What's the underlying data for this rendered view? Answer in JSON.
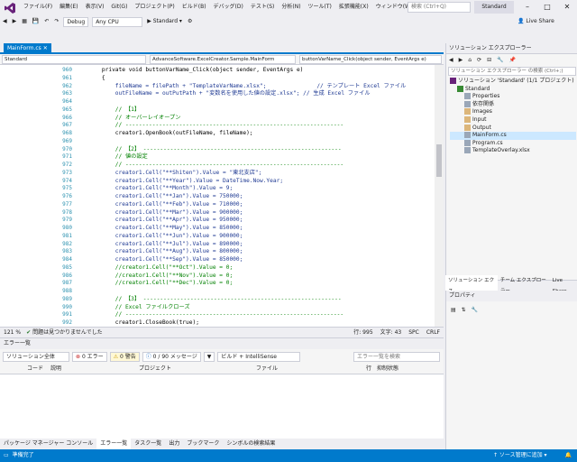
{
  "menu": {
    "items": [
      "ファイル(F)",
      "編集(E)",
      "表示(V)",
      "Git(G)",
      "プロジェクト(P)",
      "ビルド(B)",
      "デバッグ(D)",
      "テスト(S)",
      "分析(N)",
      "ツール(T)",
      "拡張機能(X)",
      "ウィンドウ(W)",
      "ヘルプ(H)"
    ],
    "search_placeholder": "検索 (Ctrl+Q)",
    "solution_name": "Standard"
  },
  "toolbar": {
    "config": "Debug",
    "platform": "Any CPU",
    "run_label": "▶ Standard ▾",
    "live_share": "Live Share"
  },
  "tabs": {
    "active": "MainForm.cs",
    "nav1": "Standard",
    "nav2": "AdvanceSoftware.ExcelCreator.Sample.MainForm",
    "nav3": "buttonVarName_Click(object sender, EventArgs e)"
  },
  "code": {
    "lines": [
      {
        "n": "960",
        "t": "    private void buttonVarName_Click(object sender, EventArgs e)",
        "k": "plain"
      },
      {
        "n": "961",
        "t": "    {",
        "k": "plain"
      },
      {
        "n": "962",
        "t": "        fileName = filePath + \"TemplateVarName.xlsx\";               // テンプレート Excel ファイル",
        "k": "mixed"
      },
      {
        "n": "963",
        "t": "        outFileName = outPutPath + \"変数名を使用した値の設定.xlsx\"; // 生成 Excel ファイル",
        "k": "mixed"
      },
      {
        "n": "964",
        "t": "",
        "k": "plain"
      },
      {
        "n": "965",
        "t": "        // 【1】",
        "k": "cm"
      },
      {
        "n": "966",
        "t": "        // オーバーレイオープン",
        "k": "cm"
      },
      {
        "n": "967",
        "t": "        // -----------------------------------------------------------------",
        "k": "cm"
      },
      {
        "n": "968",
        "t": "        creator1.OpenBook(outFileName, fileName);",
        "k": "plain"
      },
      {
        "n": "969",
        "t": "",
        "k": "plain"
      },
      {
        "n": "970",
        "t": "        // 【2】 -----------------------------------------------------------",
        "k": "cm"
      },
      {
        "n": "971",
        "t": "        // 値の設定",
        "k": "cm"
      },
      {
        "n": "972",
        "t": "        // -----------------------------------------------------------------",
        "k": "cm"
      },
      {
        "n": "973",
        "t": "        creator1.Cell(\"**Shiten\").Value = \"東北支店\";",
        "k": "mixed"
      },
      {
        "n": "974",
        "t": "        creator1.Cell(\"**Year\").Value = DateTime.Now.Year;",
        "k": "mixed"
      },
      {
        "n": "975",
        "t": "        creator1.Cell(\"**Month\").Value = 9;",
        "k": "mixed"
      },
      {
        "n": "976",
        "t": "        creator1.Cell(\"**Jan\").Value = 750000;",
        "k": "mixed"
      },
      {
        "n": "977",
        "t": "        creator1.Cell(\"**Feb\").Value = 710000;",
        "k": "mixed"
      },
      {
        "n": "978",
        "t": "        creator1.Cell(\"**Mar\").Value = 900000;",
        "k": "mixed"
      },
      {
        "n": "979",
        "t": "        creator1.Cell(\"**Apr\").Value = 950000;",
        "k": "mixed"
      },
      {
        "n": "980",
        "t": "        creator1.Cell(\"**May\").Value = 850000;",
        "k": "mixed"
      },
      {
        "n": "981",
        "t": "        creator1.Cell(\"**Jun\").Value = 900000;",
        "k": "mixed"
      },
      {
        "n": "982",
        "t": "        creator1.Cell(\"**Jul\").Value = 890000;",
        "k": "mixed"
      },
      {
        "n": "983",
        "t": "        creator1.Cell(\"**Aug\").Value = 800000;",
        "k": "mixed"
      },
      {
        "n": "984",
        "t": "        creator1.Cell(\"**Sep\").Value = 850000;",
        "k": "mixed"
      },
      {
        "n": "985",
        "t": "        //creator1.Cell(\"**Oct\").Value = 0;",
        "k": "cm"
      },
      {
        "n": "986",
        "t": "        //creator1.Cell(\"**Nov\").Value = 0;",
        "k": "cm"
      },
      {
        "n": "987",
        "t": "        //creator1.Cell(\"**Dec\").Value = 0;",
        "k": "cm"
      },
      {
        "n": "988",
        "t": "",
        "k": "plain"
      },
      {
        "n": "989",
        "t": "        // 【3】 -----------------------------------------------------------",
        "k": "cm"
      },
      {
        "n": "990",
        "t": "        // Excel ファイルクローズ",
        "k": "cm"
      },
      {
        "n": "991",
        "t": "        // -----------------------------------------------------------------",
        "k": "cm"
      },
      {
        "n": "992",
        "t": "        creator1.CloseBook(true);",
        "k": "plain"
      }
    ]
  },
  "editor_status": {
    "zoom": "121 %",
    "issues": "問題は見つかりませんでした",
    "line": "行: 995",
    "col": "文字: 43",
    "spc": "SPC",
    "crlf": "CRLF"
  },
  "error_list": {
    "title": "エラー一覧",
    "scope": "ソリューション全体",
    "errors": "0 エラー",
    "warnings": "0 警告",
    "messages": "0 / 90 メッセージ",
    "build": "ビルド + IntelliSense",
    "search_placeholder": "エラー一覧を検索",
    "columns": [
      "コード",
      "説明",
      "プロジェクト",
      "ファイル",
      "行",
      "抑制状態"
    ]
  },
  "bottom_tabs": [
    "パッケージ マネージャー コンソール",
    "エラー一覧",
    "タスク一覧",
    "出力",
    "ブックマーク",
    "シンボルの検索結果"
  ],
  "status": {
    "ready": "準備完了",
    "source_control": "↑ ソース管理に追加 ▾"
  },
  "solution_explorer": {
    "title": "ソリューション エクスプローラー",
    "search_placeholder": "ソリューション エクスプローラー の検索 (Ctrl+;)",
    "items": [
      {
        "label": "ソリューション 'Standard' (1/1 プロジェクト)",
        "depth": 0
      },
      {
        "label": "Standard",
        "depth": 1
      },
      {
        "label": "Properties",
        "depth": 2
      },
      {
        "label": "依存関係",
        "depth": 2
      },
      {
        "label": "Images",
        "depth": 2
      },
      {
        "label": "Input",
        "depth": 2
      },
      {
        "label": "Output",
        "depth": 2
      },
      {
        "label": "MainForm.cs",
        "depth": 2
      },
      {
        "label": "Program.cs",
        "depth": 2
      },
      {
        "label": "TemplateOverlay.xlsx",
        "depth": 2
      }
    ],
    "tabs": [
      "ソリューション エクス...",
      "チーム エクスプローラー",
      "Live Share"
    ]
  },
  "properties": {
    "title": "プロパティ"
  },
  "colors": {
    "accent": "#007acc",
    "comment": "#008000",
    "string": "#a31515",
    "keyword": "#0000ff"
  }
}
